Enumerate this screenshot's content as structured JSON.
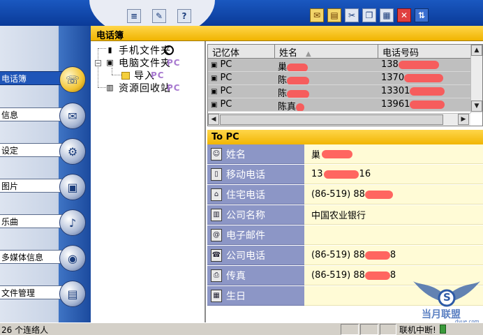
{
  "toolbar": {
    "left_buttons": [
      {
        "name": "document-icon",
        "glyph": "≡"
      },
      {
        "name": "edit-icon",
        "glyph": "✎"
      },
      {
        "name": "help-icon",
        "glyph": "?"
      }
    ],
    "right_buttons": [
      {
        "name": "mail-icon",
        "glyph": "✉"
      },
      {
        "name": "open-folder-icon",
        "glyph": "▤"
      },
      {
        "name": "tools-icon",
        "glyph": "✂"
      },
      {
        "name": "copy-icon",
        "glyph": "❐"
      },
      {
        "name": "paste-icon",
        "glyph": "▦"
      },
      {
        "name": "close-icon",
        "glyph": "✕"
      },
      {
        "name": "sort-icon",
        "glyph": "⇅"
      }
    ]
  },
  "nav": {
    "items": [
      {
        "label": "电话簿",
        "icon": "phone-icon",
        "glyph": "☏",
        "active": true
      },
      {
        "label": "信息",
        "icon": "envelope-icon",
        "glyph": "✉",
        "active": false
      },
      {
        "label": "设定",
        "icon": "settings-icon",
        "glyph": "⚙",
        "active": false
      },
      {
        "label": "图片",
        "icon": "picture-icon",
        "glyph": "▣",
        "active": false
      },
      {
        "label": "乐曲",
        "icon": "music-icon",
        "glyph": "♪",
        "active": false
      },
      {
        "label": "多媒体信息",
        "icon": "balloon-icon",
        "glyph": "◉",
        "active": false
      },
      {
        "label": "文件管理",
        "icon": "file-box-icon",
        "glyph": "▤",
        "active": false
      }
    ]
  },
  "section_title": "电话簿",
  "tree": {
    "phone_folder": "手机文件夹",
    "pc_folder": "电脑文件夹",
    "import_folder": "导入",
    "recycle_bin": "资源回收站",
    "ghost_pc": "PC"
  },
  "list": {
    "columns": [
      "记忆体",
      "姓名",
      "电话号码"
    ],
    "rows": [
      {
        "memory": "PC",
        "name": "巢",
        "phone": "138"
      },
      {
        "memory": "PC",
        "name": "陈",
        "phone": "1370"
      },
      {
        "memory": "PC",
        "name": "陈",
        "phone": "13301"
      },
      {
        "memory": "PC",
        "name": "陈真",
        "phone": "13961"
      }
    ]
  },
  "detail": {
    "title": "To PC",
    "fields": [
      {
        "label": "姓名",
        "value": "巢",
        "icon": "person-icon",
        "glyph": "☺"
      },
      {
        "label": "移动电话",
        "value": "13",
        "value_suffix": "16",
        "icon": "mobile-icon",
        "glyph": "▯"
      },
      {
        "label": "住宅电话",
        "value": "(86-519) 88",
        "icon": "home-phone-icon",
        "glyph": "⌂"
      },
      {
        "label": "公司名称",
        "value": "中国农业银行",
        "icon": "company-icon",
        "glyph": "▥"
      },
      {
        "label": "电子邮件",
        "value": "",
        "icon": "email-icon",
        "glyph": "@"
      },
      {
        "label": "公司电话",
        "value": "(86-519) 88",
        "value_suffix": "8",
        "icon": "office-phone-icon",
        "glyph": "☎"
      },
      {
        "label": "传真",
        "value": "(86-519) 88",
        "value_suffix": "8",
        "icon": "fax-icon",
        "glyph": "⎙"
      },
      {
        "label": "生日",
        "value": "",
        "icon": "birthday-icon",
        "glyph": "▦"
      }
    ]
  },
  "status": {
    "contacts": "26 个连络人",
    "connection": "联机中断!"
  },
  "watermark": {
    "text": "当月联盟",
    "url": "dyue.com",
    "badge": "S"
  },
  "colors": {
    "accent_yellow": "#f0b400",
    "nav_blue": "#1f55b8",
    "label_purple": "#8c96c6",
    "value_cream": "#fffbd6",
    "redaction_red": "#ff4b4b"
  }
}
